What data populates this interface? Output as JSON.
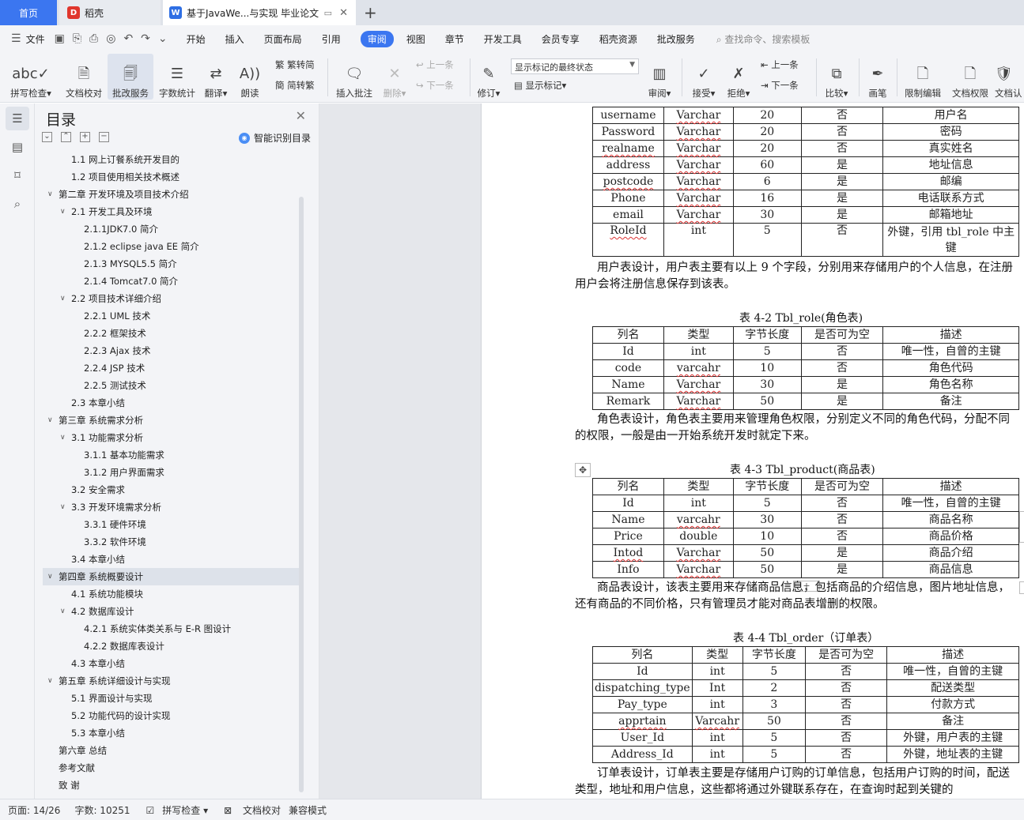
{
  "tabs": {
    "home": "首页",
    "daoke": "稻壳",
    "doc": "基于JavaWe...与实现 毕业论文"
  },
  "menu": {
    "file": "文件",
    "items": [
      "开始",
      "插入",
      "页面布局",
      "引用",
      "审阅",
      "视图",
      "章节",
      "开发工具",
      "会员专享",
      "稻壳资源",
      "批改服务"
    ],
    "search": "查找命令、搜索模板"
  },
  "ribbon": {
    "spell": "拼写检查",
    "proof": "文档校对",
    "correct": "批改服务",
    "wordcount": "字数统计",
    "translate": "翻译",
    "read": "朗读",
    "to_trad": "繁转简",
    "to_simp": "简转繁",
    "insert_comment": "插入批注",
    "delete": "删除",
    "prev": "上一条",
    "next": "下一条",
    "revise": "修订",
    "mark_state": "显示标记的最终状态",
    "show_marks": "显示标记",
    "review": "审阅",
    "accept": "接受",
    "reject": "拒绝",
    "prev2": "上一条",
    "next2": "下一条",
    "compare": "比较",
    "pen": "画笔",
    "restrict": "限制编辑",
    "permission": "文档权限",
    "docauth": "文档认"
  },
  "toc": {
    "title": "目录",
    "smart": "智能识别目录",
    "items": [
      {
        "label": "1.1  网上订餐系统开发目的",
        "level": 2,
        "arrow": ""
      },
      {
        "label": "1.2  项目使用相关技术概述",
        "level": 2,
        "arrow": ""
      },
      {
        "label": "第二章  开发环境及项目技术介绍",
        "level": 1,
        "arrow": "v"
      },
      {
        "label": "2.1  开发工具及环境",
        "level": 2,
        "arrow": "v"
      },
      {
        "label": "2.1.1JDK7.0 简介",
        "level": 3,
        "arrow": ""
      },
      {
        "label": "2.1.2 eclipse java EE 简介",
        "level": 3,
        "arrow": ""
      },
      {
        "label": "2.1.3 MYSQL5.5 简介",
        "level": 3,
        "arrow": ""
      },
      {
        "label": "2.1.4 Tomcat7.0 简介",
        "level": 3,
        "arrow": ""
      },
      {
        "label": "2.2  项目技术详细介绍",
        "level": 2,
        "arrow": "v"
      },
      {
        "label": "2.2.1 UML 技术",
        "level": 3,
        "arrow": ""
      },
      {
        "label": "2.2.2  框架技术",
        "level": 3,
        "arrow": ""
      },
      {
        "label": "2.2.3 Ajax 技术",
        "level": 3,
        "arrow": ""
      },
      {
        "label": "2.2.4 JSP 技术",
        "level": 3,
        "arrow": ""
      },
      {
        "label": "2.2.5  测试技术",
        "level": 3,
        "arrow": ""
      },
      {
        "label": "2.3  本章小结",
        "level": 2,
        "arrow": ""
      },
      {
        "label": "第三章  系统需求分析",
        "level": 1,
        "arrow": "v"
      },
      {
        "label": "3.1  功能需求分析",
        "level": 2,
        "arrow": "v"
      },
      {
        "label": "3.1.1  基本功能需求",
        "level": 3,
        "arrow": ""
      },
      {
        "label": "3.1.2  用户界面需求",
        "level": 3,
        "arrow": ""
      },
      {
        "label": "3.2  安全需求",
        "level": 2,
        "arrow": ""
      },
      {
        "label": "3.3 开发环境需求分析",
        "level": 2,
        "arrow": "v"
      },
      {
        "label": "3.3.1  硬件环境",
        "level": 3,
        "arrow": ""
      },
      {
        "label": "3.3.2  软件环境",
        "level": 3,
        "arrow": ""
      },
      {
        "label": "3.4  本章小结",
        "level": 2,
        "arrow": ""
      },
      {
        "label": "第四章  系统概要设计",
        "level": 1,
        "arrow": "v",
        "selected": true
      },
      {
        "label": "4.1  系统功能模块",
        "level": 2,
        "arrow": ""
      },
      {
        "label": "4.2  数据库设计",
        "level": 2,
        "arrow": "v"
      },
      {
        "label": "4.2.1  系统实体类关系与 E-R 图设计",
        "level": 3,
        "arrow": ""
      },
      {
        "label": "4.2.2  数据库表设计",
        "level": 3,
        "arrow": ""
      },
      {
        "label": "4.3  本章小结",
        "level": 2,
        "arrow": ""
      },
      {
        "label": "第五章  系统详细设计与实现",
        "level": 1,
        "arrow": "v"
      },
      {
        "label": "5.1  界面设计与实现",
        "level": 2,
        "arrow": ""
      },
      {
        "label": "5.2  功能代码的设计实现",
        "level": 2,
        "arrow": ""
      },
      {
        "label": "5.3  本章小结",
        "level": 2,
        "arrow": ""
      },
      {
        "label": "第六章  总结",
        "level": 1,
        "arrow": ""
      },
      {
        "label": "参考文献",
        "level": 1,
        "arrow": ""
      },
      {
        "label": "致  谢",
        "level": 1,
        "arrow": ""
      }
    ]
  },
  "document": {
    "user_table": {
      "rows": [
        [
          "username",
          "Varchar",
          "20",
          "否",
          "用户名"
        ],
        [
          "Password",
          "Varchar",
          "20",
          "否",
          "密码"
        ],
        [
          "realname",
          "Varchar",
          "20",
          "否",
          "真实姓名"
        ],
        [
          "address",
          "Varchar",
          "60",
          "是",
          "地址信息"
        ],
        [
          "postcode",
          "Varchar",
          "6",
          "是",
          "邮编"
        ],
        [
          "Phone",
          "Varchar",
          "16",
          "是",
          "电话联系方式"
        ],
        [
          "email",
          "Varchar",
          "30",
          "是",
          "邮箱地址"
        ],
        [
          "RoleId",
          "int",
          "5",
          "否",
          "外键，引用 tbl_role 中主键"
        ]
      ]
    },
    "para1": "用户表设计，用户表主要有以上 9 个字段，分别用来存储用户的个人信息，在注册用户会将注册信息保存到该表。",
    "role_caption": "表 4-2 Tbl_role(角色表)",
    "role_table": {
      "headers": [
        "列名",
        "类型",
        "字节长度",
        "是否可为空",
        "描述"
      ],
      "rows": [
        [
          "Id",
          "int",
          "5",
          "否",
          "唯一性，自曾的主键"
        ],
        [
          "code",
          "varcahr",
          "10",
          "否",
          "角色代码"
        ],
        [
          "Name",
          "Varchar",
          "30",
          "是",
          "角色名称"
        ],
        [
          "Remark",
          "Varchar",
          "50",
          "是",
          "备注"
        ]
      ]
    },
    "para2": "角色表设计，角色表主要用来管理角色权限，分别定义不同的角色代码，分配不同的权限，一般是由一开始系统开发时就定下来。",
    "product_caption": "表 4-3 Tbl_product(商品表)",
    "product_table": {
      "headers": [
        "列名",
        "类型",
        "字节长度",
        "是否可为空",
        "描述"
      ],
      "rows": [
        [
          "Id",
          "int",
          "5",
          "否",
          "唯一性，自曾的主键"
        ],
        [
          "Name",
          "varcahr",
          "30",
          "否",
          "商品名称"
        ],
        [
          "Price",
          "double",
          "10",
          "否",
          "商品价格"
        ],
        [
          "Intod",
          "Varchar",
          "50",
          "是",
          "商品介绍"
        ],
        [
          "Info",
          "Varchar",
          "50",
          "是",
          "商品信息"
        ]
      ]
    },
    "para3": "商品表设计，该表主要用来存储商品信息，包括商品的介绍信息，图片地址信息，还有商品的不同价格，只有管理员才能对商品表增删的权限。",
    "order_caption": "表 4-4 Tbl_order（订单表）",
    "order_table": {
      "headers": [
        "列名",
        "类型",
        "字节长度",
        "是否可为空",
        "描述"
      ],
      "rows": [
        [
          "Id",
          "int",
          "5",
          "否",
          "唯一性，自曾的主键"
        ],
        [
          "dispatching_type",
          "Int",
          "2",
          "否",
          "配送类型"
        ],
        [
          "Pay_type",
          "int",
          "3",
          "否",
          "付款方式"
        ],
        [
          "apprtain",
          "Varcahr",
          "50",
          "否",
          "备注"
        ],
        [
          "User_Id",
          "int",
          "5",
          "否",
          "外键，用户表的主键"
        ],
        [
          "Address_Id",
          "int",
          "5",
          "否",
          "外键，地址表的主键"
        ]
      ]
    },
    "para4": "订单表设计，订单表主要是存储用户订购的订单信息，包括用户订购的时间，配送类型，地址和用户信息，这些都将通过外键联系存在，在查询时起到关键的"
  },
  "status": {
    "page": "页面: 14/26",
    "words": "字数: 10251",
    "spell": "拼写检查",
    "proof": "文档校对",
    "compat": "兼容模式"
  }
}
